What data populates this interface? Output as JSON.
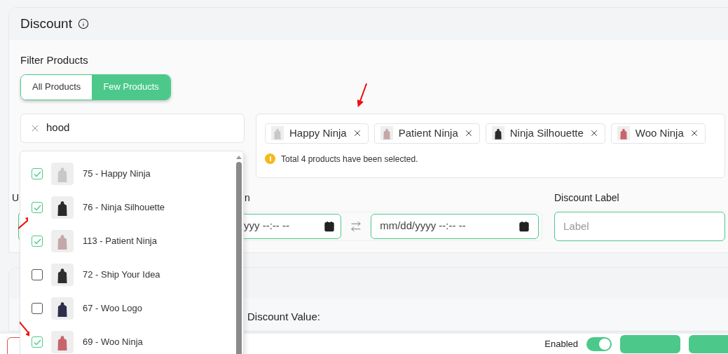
{
  "section": {
    "title": "Discount"
  },
  "filter": {
    "label": "Filter Products",
    "options": [
      {
        "label": "All Products",
        "selected": false
      },
      {
        "label": "Few Products",
        "selected": true
      }
    ]
  },
  "search": {
    "value": "hood"
  },
  "results": [
    {
      "name": "75 - Happy Ninja",
      "checked": true,
      "color": "#c8c8c8"
    },
    {
      "name": "76 - Ninja Silhouette",
      "checked": true,
      "color": "#2a2a2a"
    },
    {
      "name": "113 - Patient Ninja",
      "checked": true,
      "color": "#c4a8a8"
    },
    {
      "name": "72 - Ship Your Idea",
      "checked": false,
      "color": "#2e2e2e"
    },
    {
      "name": "67 - Woo Logo",
      "checked": false,
      "color": "#2b2f4a"
    },
    {
      "name": "69 - Woo Ninja",
      "checked": true,
      "color": "#c9646b"
    }
  ],
  "selected_products": [
    {
      "name": "Happy Ninja",
      "color": "#c8c8c8"
    },
    {
      "name": "Patient Ninja",
      "color": "#c4a8a8"
    },
    {
      "name": "Ninja Silhouette",
      "color": "#2a2a2a"
    },
    {
      "name": "Woo Ninja",
      "color": "#c9646b"
    }
  ],
  "selected_note": "Total 4 products have been selected.",
  "schedule": {
    "label_1": "U",
    "label_2": "n",
    "start": "yyy --:-- --",
    "end": "mm/dd/yyyy --:-- --"
  },
  "discount_label": {
    "label": "Discount Label",
    "placeholder": "Label"
  },
  "discount_value": {
    "label": "Discount Value:"
  },
  "footer": {
    "enabled_label": "Enabled",
    "enabled": true
  }
}
